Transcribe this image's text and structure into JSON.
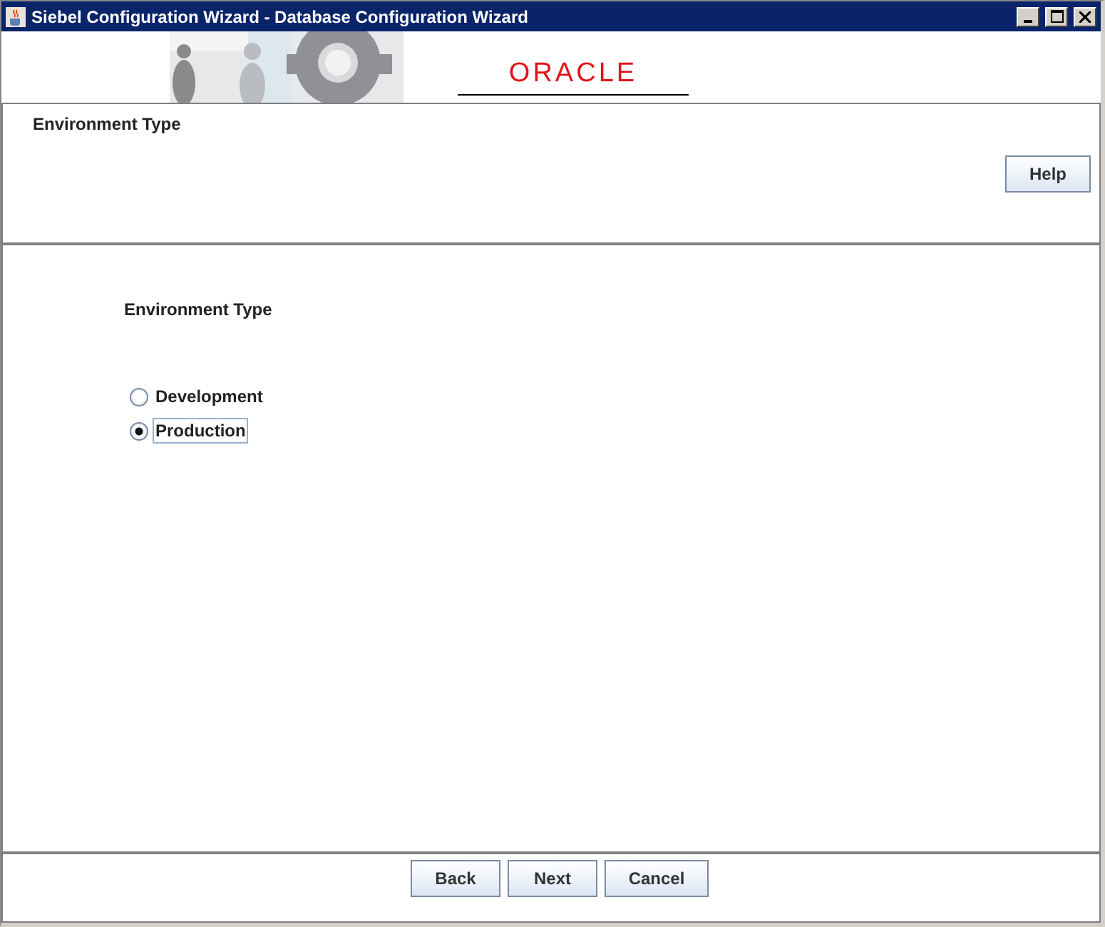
{
  "window": {
    "title": "Siebel Configuration Wizard - Database Configuration Wizard"
  },
  "banner": {
    "logo": "ORACLE"
  },
  "header": {
    "title": "Environment Type",
    "help_button": "Help"
  },
  "content": {
    "heading": "Environment Type",
    "options": [
      {
        "label": "Development",
        "selected": false,
        "focused": false
      },
      {
        "label": "Production",
        "selected": true,
        "focused": true
      }
    ]
  },
  "buttons": [
    "Back",
    "Next",
    "Cancel"
  ]
}
